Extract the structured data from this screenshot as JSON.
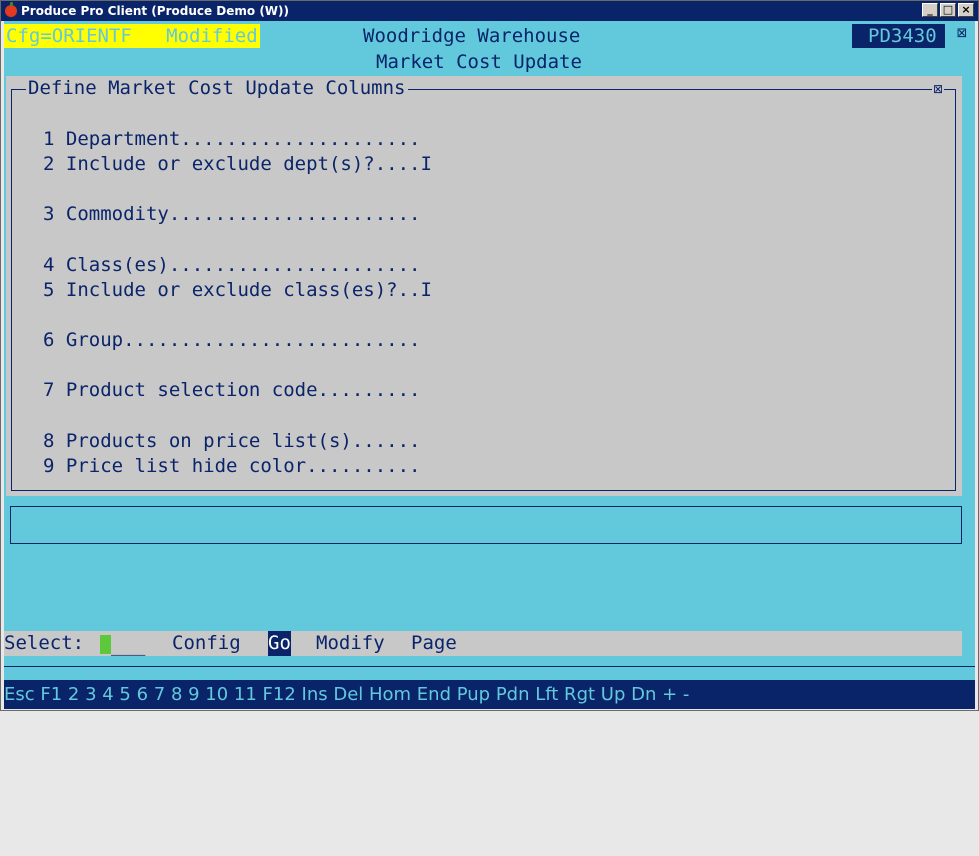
{
  "window": {
    "title": "Produce Pro Client (Produce Demo (W))",
    "buttons": [
      "_",
      "□",
      "×"
    ]
  },
  "header": {
    "config_label": "Cfg=ORIENTF   Modified",
    "warehouse": "Woodridge Warehouse",
    "program_code": "PD3430",
    "screen_title": "Market Cost Update"
  },
  "panel": {
    "title": "Define Market Cost Update Columns",
    "close_glyph": "⊠",
    "fields": [
      {
        "text": "1 Department....................."
      },
      {
        "text": "2 Include or exclude dept(s)?....I"
      },
      {
        "text": "3 Commodity......................"
      },
      {
        "text": "4 Class(es)......................"
      },
      {
        "text": "5 Include or exclude class(es)?..I"
      },
      {
        "text": "6 Group.........................."
      },
      {
        "text": "7 Product selection code........."
      },
      {
        "text": "8 Products on price list(s)......"
      },
      {
        "text": "9 Price list hide color.........."
      }
    ]
  },
  "menu": {
    "select_label": "Select:",
    "select_blank": "___",
    "items": [
      {
        "label": "Config"
      },
      {
        "label": "Go"
      },
      {
        "label": "Modify"
      },
      {
        "label": "Page"
      }
    ]
  },
  "function_keys": "Esc F1 2 3 4 5 6 7 8 9 10 11 F12 Ins Del Hom End Pup Pdn Lft Rgt Up Dn + -",
  "colors": {
    "background": "#62c9dc",
    "panel": "#c8c8c8",
    "text": "#0a246a",
    "highlight": "#ffff00",
    "cursor": "#5cc83a"
  }
}
